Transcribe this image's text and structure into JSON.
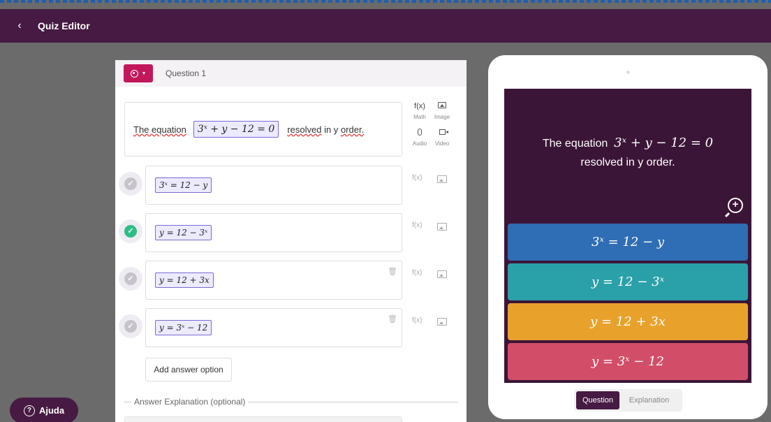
{
  "topbar": {
    "back_icon": "chevron-left-icon",
    "title": "Quiz Editor"
  },
  "editor": {
    "question_label": "Question 1",
    "question": {
      "text_before": "The equation",
      "math": "3ˣ + y − 12 = 0",
      "text_after_1": "resolved",
      "text_after_2": "in y",
      "text_after_3": "order."
    },
    "tools": [
      {
        "icon": "fx-icon",
        "glyph": "f(x)",
        "label": "Math"
      },
      {
        "icon": "image-icon",
        "label": "Image"
      },
      {
        "icon": "microphone-icon",
        "label": "Audio"
      },
      {
        "icon": "video-icon",
        "label": "Video"
      }
    ],
    "answers": [
      {
        "math": "3ˣ = 12 − y",
        "correct": false
      },
      {
        "math": "y = 12 − 3ˣ",
        "correct": true
      },
      {
        "math": "y = 12 + 3x",
        "correct": false
      },
      {
        "math": "y = 3ˣ − 12",
        "correct": false
      }
    ],
    "fx_glyph": "f(x)",
    "check_glyph": "✓",
    "trash_glyph": "🗑",
    "add_answer_label": "Add answer option",
    "explanation_label": "Answer Explanation (optional)"
  },
  "help": {
    "label": "Ajuda",
    "glyph": "?"
  },
  "preview": {
    "question_line1_text": "The equation",
    "question_line1_math": "3ˣ + y − 12 = 0",
    "question_line2": "resolved in y order.",
    "zoom_glyph": "+",
    "options": [
      {
        "math": "3ˣ = 12 − y",
        "color": "#2f6db4"
      },
      {
        "math": "y = 12 − 3ˣ",
        "color": "#2aa0a8"
      },
      {
        "math": "y = 12 + 3x",
        "color": "#e8a22c"
      },
      {
        "math": "y = 3ˣ − 12",
        "color": "#d24d68"
      }
    ],
    "tabs": {
      "question": "Question",
      "explanation": "Explanation",
      "active": "question"
    }
  },
  "colors": {
    "topbar": "#461a42",
    "accent": "#c2185b",
    "correct": "#2ebd85"
  }
}
